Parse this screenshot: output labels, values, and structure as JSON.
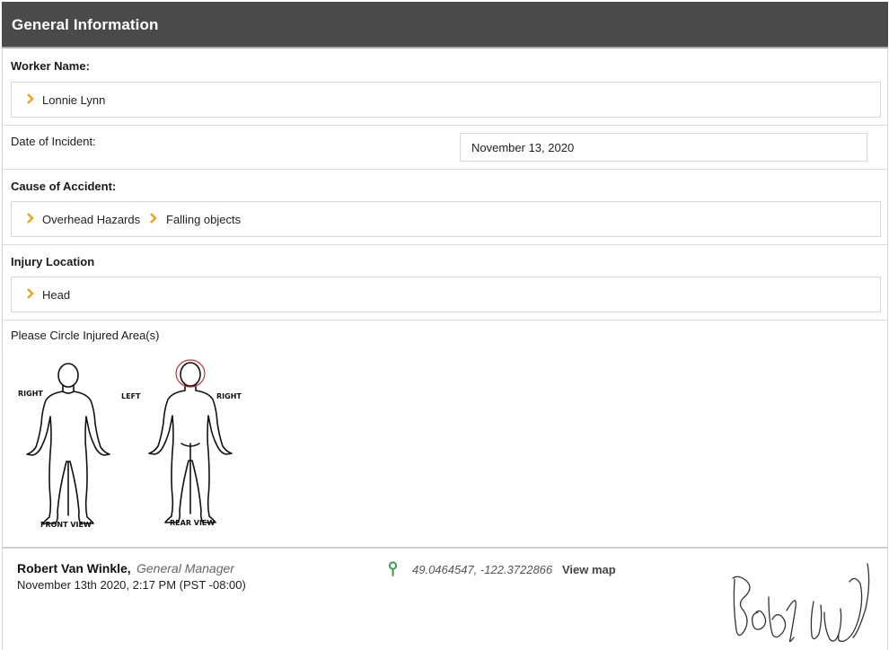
{
  "header": {
    "title": "General Information"
  },
  "worker": {
    "label": "Worker Name:",
    "value": "Lonnie Lynn"
  },
  "date": {
    "label": "Date of Incident:",
    "value": "November 13, 2020"
  },
  "cause": {
    "label": "Cause of Accident:",
    "path": [
      "Overhead Hazards",
      "Falling objects"
    ]
  },
  "injury": {
    "label": "Injury Location",
    "value": "Head"
  },
  "diagram": {
    "label": "Please Circle Injured Area(s)",
    "right_front": "RIGHT",
    "left": "LEFT",
    "right_rear": "RIGHT",
    "front_caption": "FRONT VIEW",
    "rear_caption": "REAR VIEW",
    "circled_area": "head",
    "circle_color": "#c0303a"
  },
  "footer": {
    "name": "Robert Van Winkle,",
    "role": "General Manager",
    "timestamp": "November 13th 2020, 2:17 PM (PST -08:00)",
    "coordinates": "49.0464547, -122.3722866",
    "view_map": "View map",
    "pin_color": "#3c9a4e"
  },
  "colors": {
    "header_bg": "#4a4a4a",
    "chevron": "#f0a01c"
  }
}
